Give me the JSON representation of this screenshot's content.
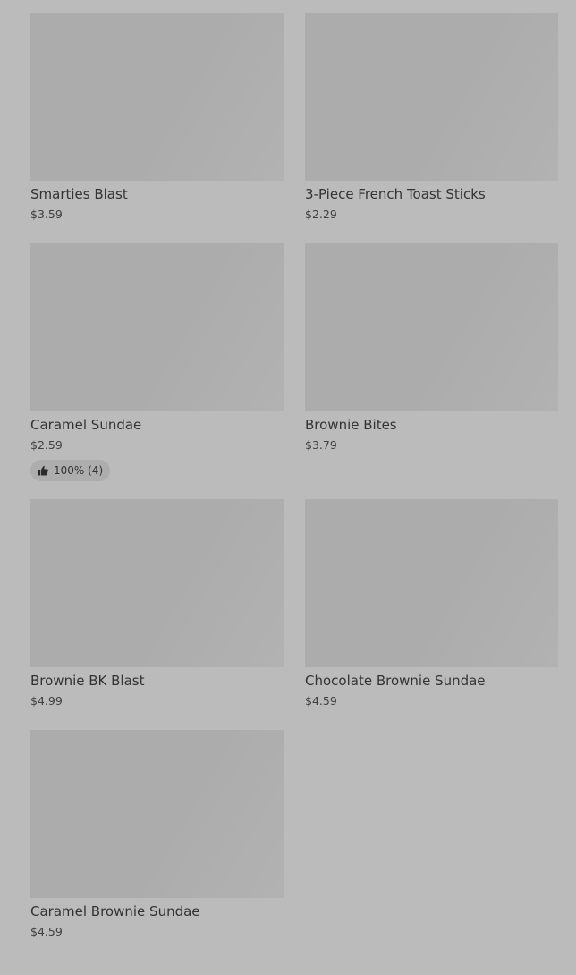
{
  "menu_items": [
    {
      "name": "Smarties Blast",
      "price": "$3.59"
    },
    {
      "name": "3-Piece French Toast Sticks",
      "price": "$2.29"
    },
    {
      "name": "Caramel Sundae",
      "price": "$2.59",
      "rating": {
        "icon": "thumbs-up-icon",
        "text": "100% (4)"
      }
    },
    {
      "name": "Brownie Bites",
      "price": "$3.79"
    },
    {
      "name": "Brownie BK Blast",
      "price": "$4.99"
    },
    {
      "name": "Chocolate Brownie Sundae",
      "price": "$4.59"
    },
    {
      "name": "Caramel Brownie Sundae",
      "price": "$4.59"
    }
  ]
}
